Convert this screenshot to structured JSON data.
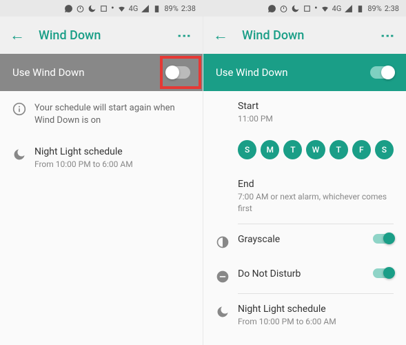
{
  "status": {
    "network": "4G",
    "battery": "89%",
    "time": "2:38"
  },
  "app": {
    "title": "Wind Down"
  },
  "left": {
    "hero_label": "Use Wind Down",
    "info_text": "Your schedule will start again when Wind Down is on",
    "night_light": {
      "title": "Night Light schedule",
      "sub": "From 10:00 PM to 6:00 AM"
    }
  },
  "right": {
    "hero_label": "Use Wind Down",
    "start": {
      "title": "Start",
      "sub": "11:00 PM"
    },
    "days": [
      "S",
      "M",
      "T",
      "W",
      "T",
      "F",
      "S"
    ],
    "end": {
      "title": "End",
      "sub": "7:00 AM or next alarm, whichever comes first"
    },
    "grayscale": {
      "title": "Grayscale"
    },
    "dnd": {
      "title": "Do Not Disturb"
    },
    "night_light": {
      "title": "Night Light schedule",
      "sub": "From 10:00 PM to 6:00 AM"
    }
  }
}
